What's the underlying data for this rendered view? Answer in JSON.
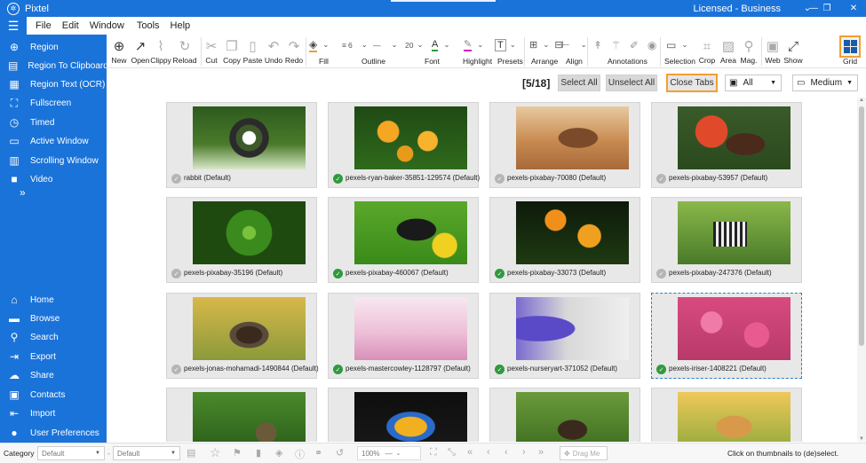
{
  "app": {
    "title": "Pixtel",
    "license": "Licensed - Business",
    "window_controls": [
      "⌄",
      "—",
      "❐",
      "✕"
    ]
  },
  "menu": [
    "File",
    "Edit",
    "Window",
    "Tools",
    "Help"
  ],
  "sidebar": {
    "capture_items": [
      "Region",
      "Region To Clipboard",
      "Region Text (OCR)",
      "Fullscreen",
      "Timed",
      "Active Window",
      "Scrolling Window",
      "Video"
    ],
    "more": "»",
    "nav_items": [
      "Home",
      "Browse",
      "Search",
      "Export",
      "Share",
      "Contacts",
      "Import",
      "User Preferences"
    ]
  },
  "toolbar": {
    "new": "New",
    "open": "Open",
    "clippy": "Clippy",
    "reload": "Reload",
    "cut": "Cut",
    "copy": "Copy",
    "paste": "Paste",
    "undo": "Undo",
    "redo": "Redo",
    "fill": "Fill",
    "outline": "Outline",
    "outline_width": "6",
    "font": "Font",
    "font_size": "20",
    "highlight": "Highlight",
    "presets": "Presets",
    "arrange": "Arrange",
    "align": "Align",
    "annotations": "Annotations",
    "selection": "Selection",
    "crop": "Crop",
    "area": "Area",
    "mag": "Mag.",
    "web": "Web",
    "show": "Show",
    "grid": "Grid"
  },
  "controls": {
    "counter": "[5/18]",
    "select_all": "Select All",
    "unselect_all": "Unselect All",
    "close_tabs": "Close Tabs",
    "filter_value": "All",
    "size_value": "Medium"
  },
  "thumbnails": [
    {
      "caption": "rabbit (Default)",
      "checked": false
    },
    {
      "caption": "pexels-ryan-baker-35851-129574 (Default)",
      "checked": true
    },
    {
      "caption": "pexels-pixabay-70080 (Default)",
      "checked": false
    },
    {
      "caption": "pexels-pixabay-53957 (Default)",
      "checked": false
    },
    {
      "caption": "pexels-pixabay-35196 (Default)",
      "checked": false
    },
    {
      "caption": "pexels-pixabay-460067 (Default)",
      "checked": true
    },
    {
      "caption": "pexels-pixabay-33073 (Default)",
      "checked": true
    },
    {
      "caption": "pexels-pixabay-247376 (Default)",
      "checked": false
    },
    {
      "caption": "pexels-jonas-mohamadi-1490844 (Default)",
      "checked": false
    },
    {
      "caption": "pexels-mastercowley-1128797 (Default)",
      "checked": true
    },
    {
      "caption": "pexels-nurseryart-371052 (Default)",
      "checked": true
    },
    {
      "caption": "pexels-iriser-1408221 (Default)",
      "checked": true
    }
  ],
  "status": {
    "category_label": "Category",
    "category_value": "Default",
    "second_value": "Default",
    "zoom": "100%",
    "drag_me": "Drag Me",
    "hint": "Click on thumbnails to (de)select."
  },
  "colors": {
    "accent": "#1a73d9",
    "highlight_border": "#f0a030",
    "check_on": "#2e9a3e",
    "check_off": "#b5b5b5"
  }
}
